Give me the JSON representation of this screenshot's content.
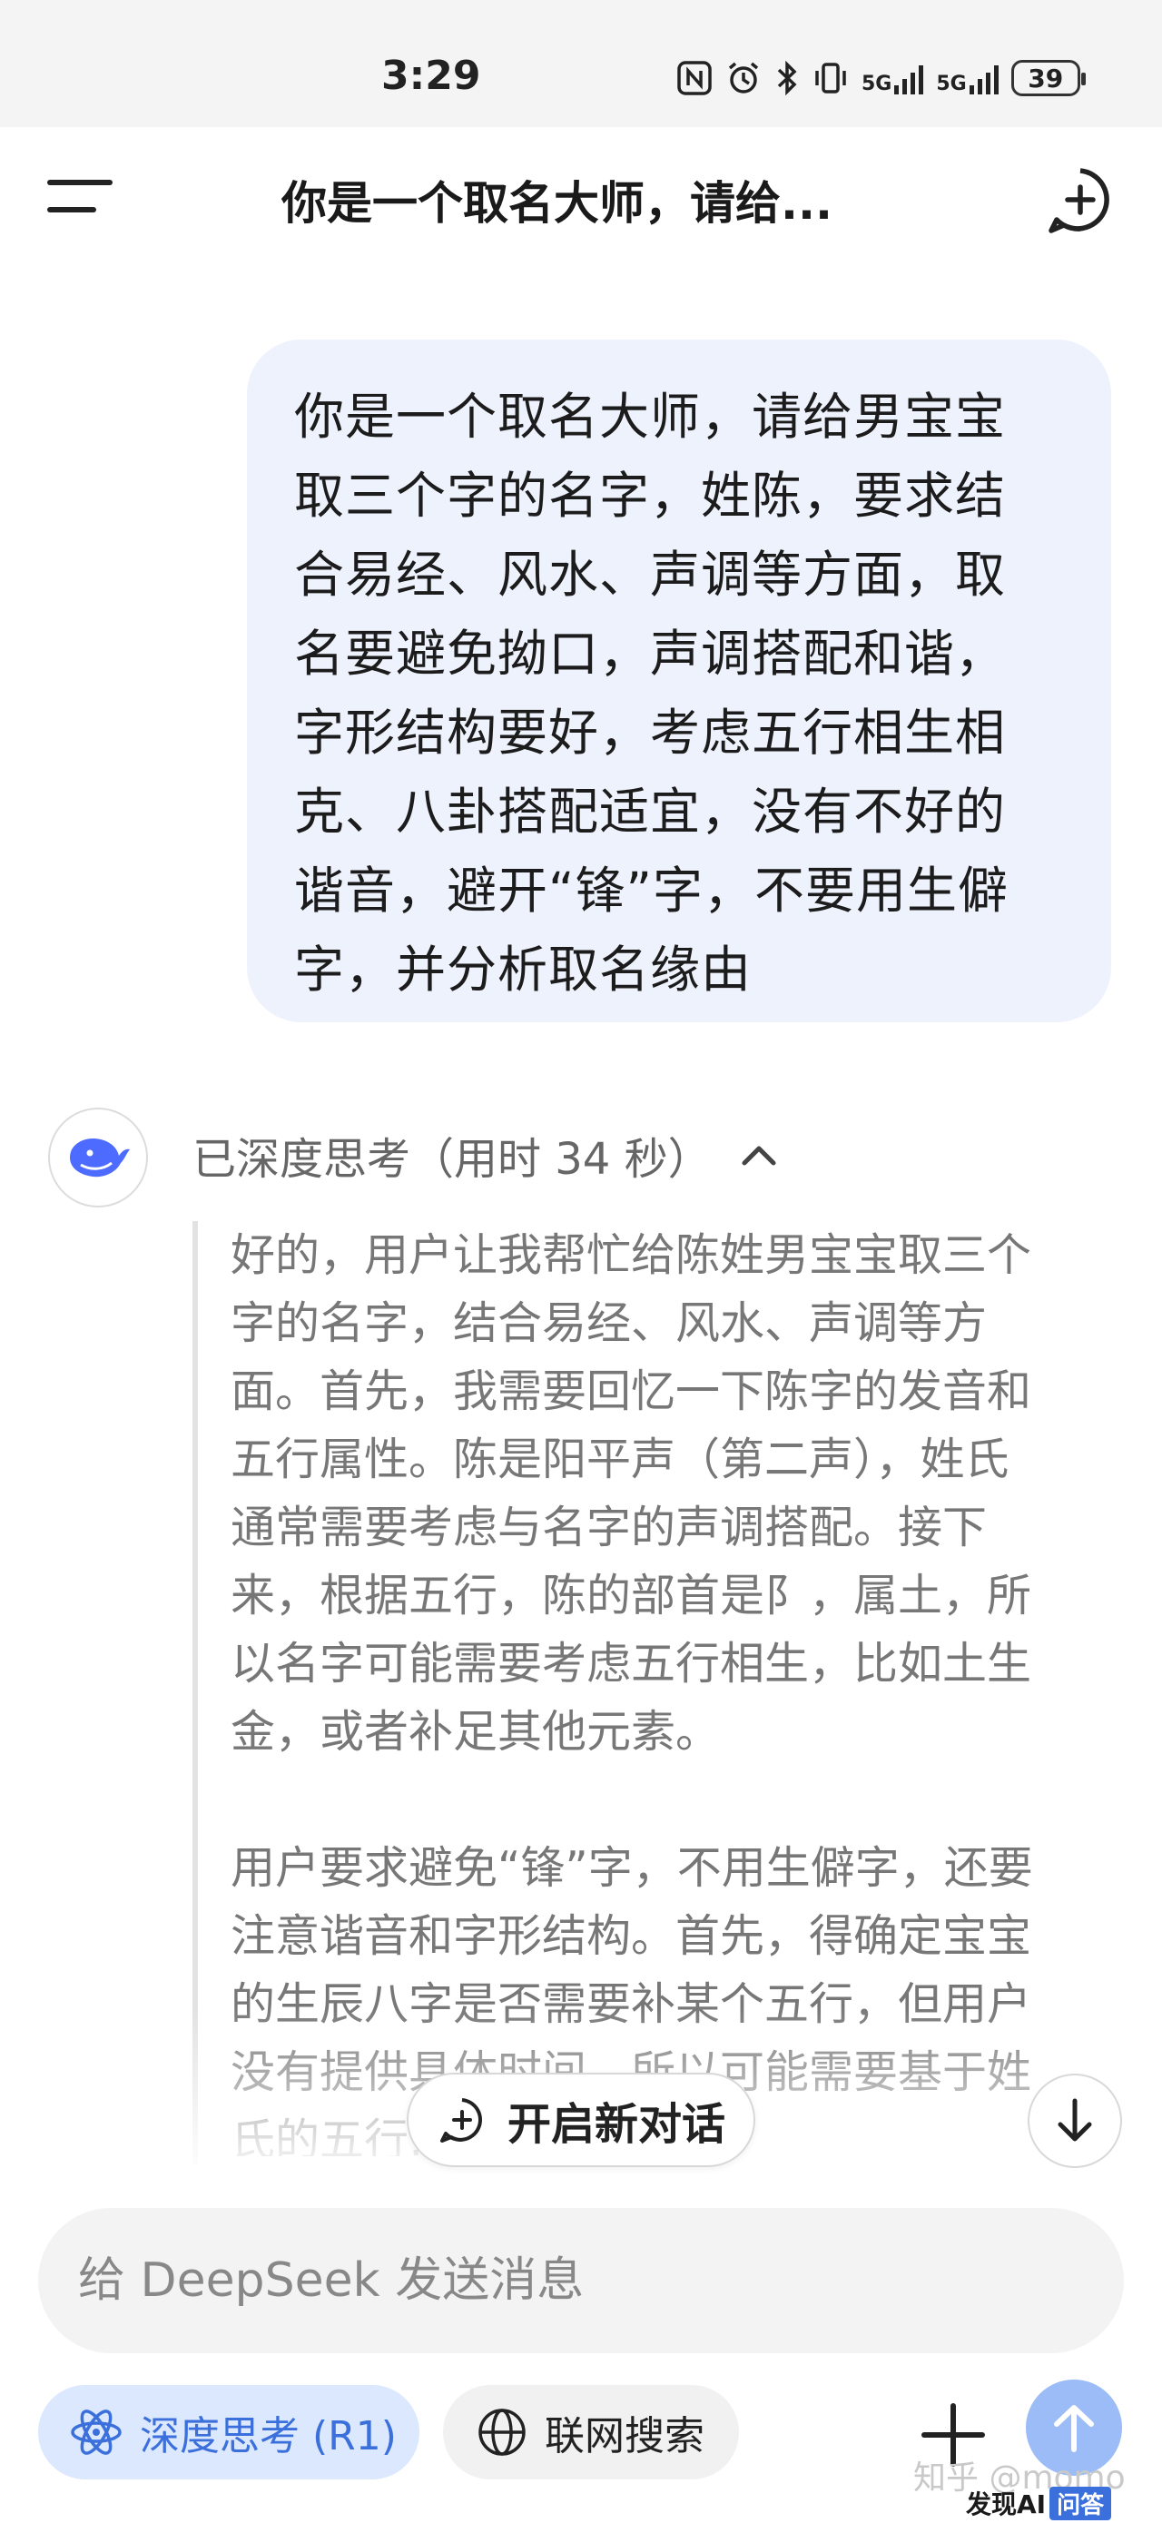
{
  "status_bar": {
    "time": "3:29",
    "battery": "39",
    "signal_1": "5G",
    "signal_2": "5G",
    "icons": [
      "nfc-icon",
      "alarm-icon",
      "bluetooth-icon",
      "vibrate-icon",
      "signal-icon",
      "signal-icon",
      "battery-icon"
    ]
  },
  "header": {
    "title": "你是一个取名大师，请给...",
    "menu_icon": "menu-icon",
    "new_chat_icon": "new-chat-icon"
  },
  "user_message": {
    "lines": [
      "你是一个取名大师，请给男宝宝",
      "取三个字的名字，姓陈，要求结",
      "合易经、风水、声调等方面，取",
      "名要避免拗口，声调搭配和谐，",
      "字形结构要好，考虑五行相生相",
      "克、八卦搭配适宜，没有不好的",
      "谐音，避开“锋”字，不要用生僻",
      "字，并分析取名缘由"
    ]
  },
  "assistant": {
    "avatar_icon": "deepseek-whale-icon",
    "thinking_label": "已深度思考（用时 34 秒）",
    "thinking_paragraphs": [
      [
        "好的，用户让我帮忙给陈姓男宝宝取三个",
        "字的名字，结合易经、风水、声调等方",
        "面。首先，我需要回忆一下陈字的发音和",
        "五行属性。陈是阳平声（第二声），姓氏",
        "通常需要考虑与名字的声调搭配。接下",
        "来，根据五行，陈的部首是阝，属土，所",
        "以名字可能需要考虑五行相生，比如土生",
        "金，或者补足其他元素。"
      ],
      [
        "用户要求避免“锋”字，不用生僻字，还要",
        "注意谐音和字形结构。首先，得确定宝宝",
        "的生辰八字是否需要补某个五行，但用户",
        "没有提供具体时间，所以可能需要基于姓",
        "氏的五行……那么名字可"
      ]
    ]
  },
  "floating": {
    "new_chat_label": "开启新对话",
    "scroll_down_icon": "arrow-down-icon"
  },
  "composer": {
    "placeholder": "给 DeepSeek 发送消息",
    "deep_think_label": "深度思考 (R1)",
    "web_search_label": "联网搜索",
    "attach_icon": "plus-icon",
    "send_icon": "arrow-up-icon"
  },
  "watermark": {
    "text": "知乎 @momo",
    "badge_ai": "发现AI",
    "badge_qa": "问答"
  },
  "colors": {
    "user_bubble": "#eef2fd",
    "accent": "#3b6fdc",
    "send_button": "#9bbcf6",
    "thinking_text": "#777777"
  }
}
